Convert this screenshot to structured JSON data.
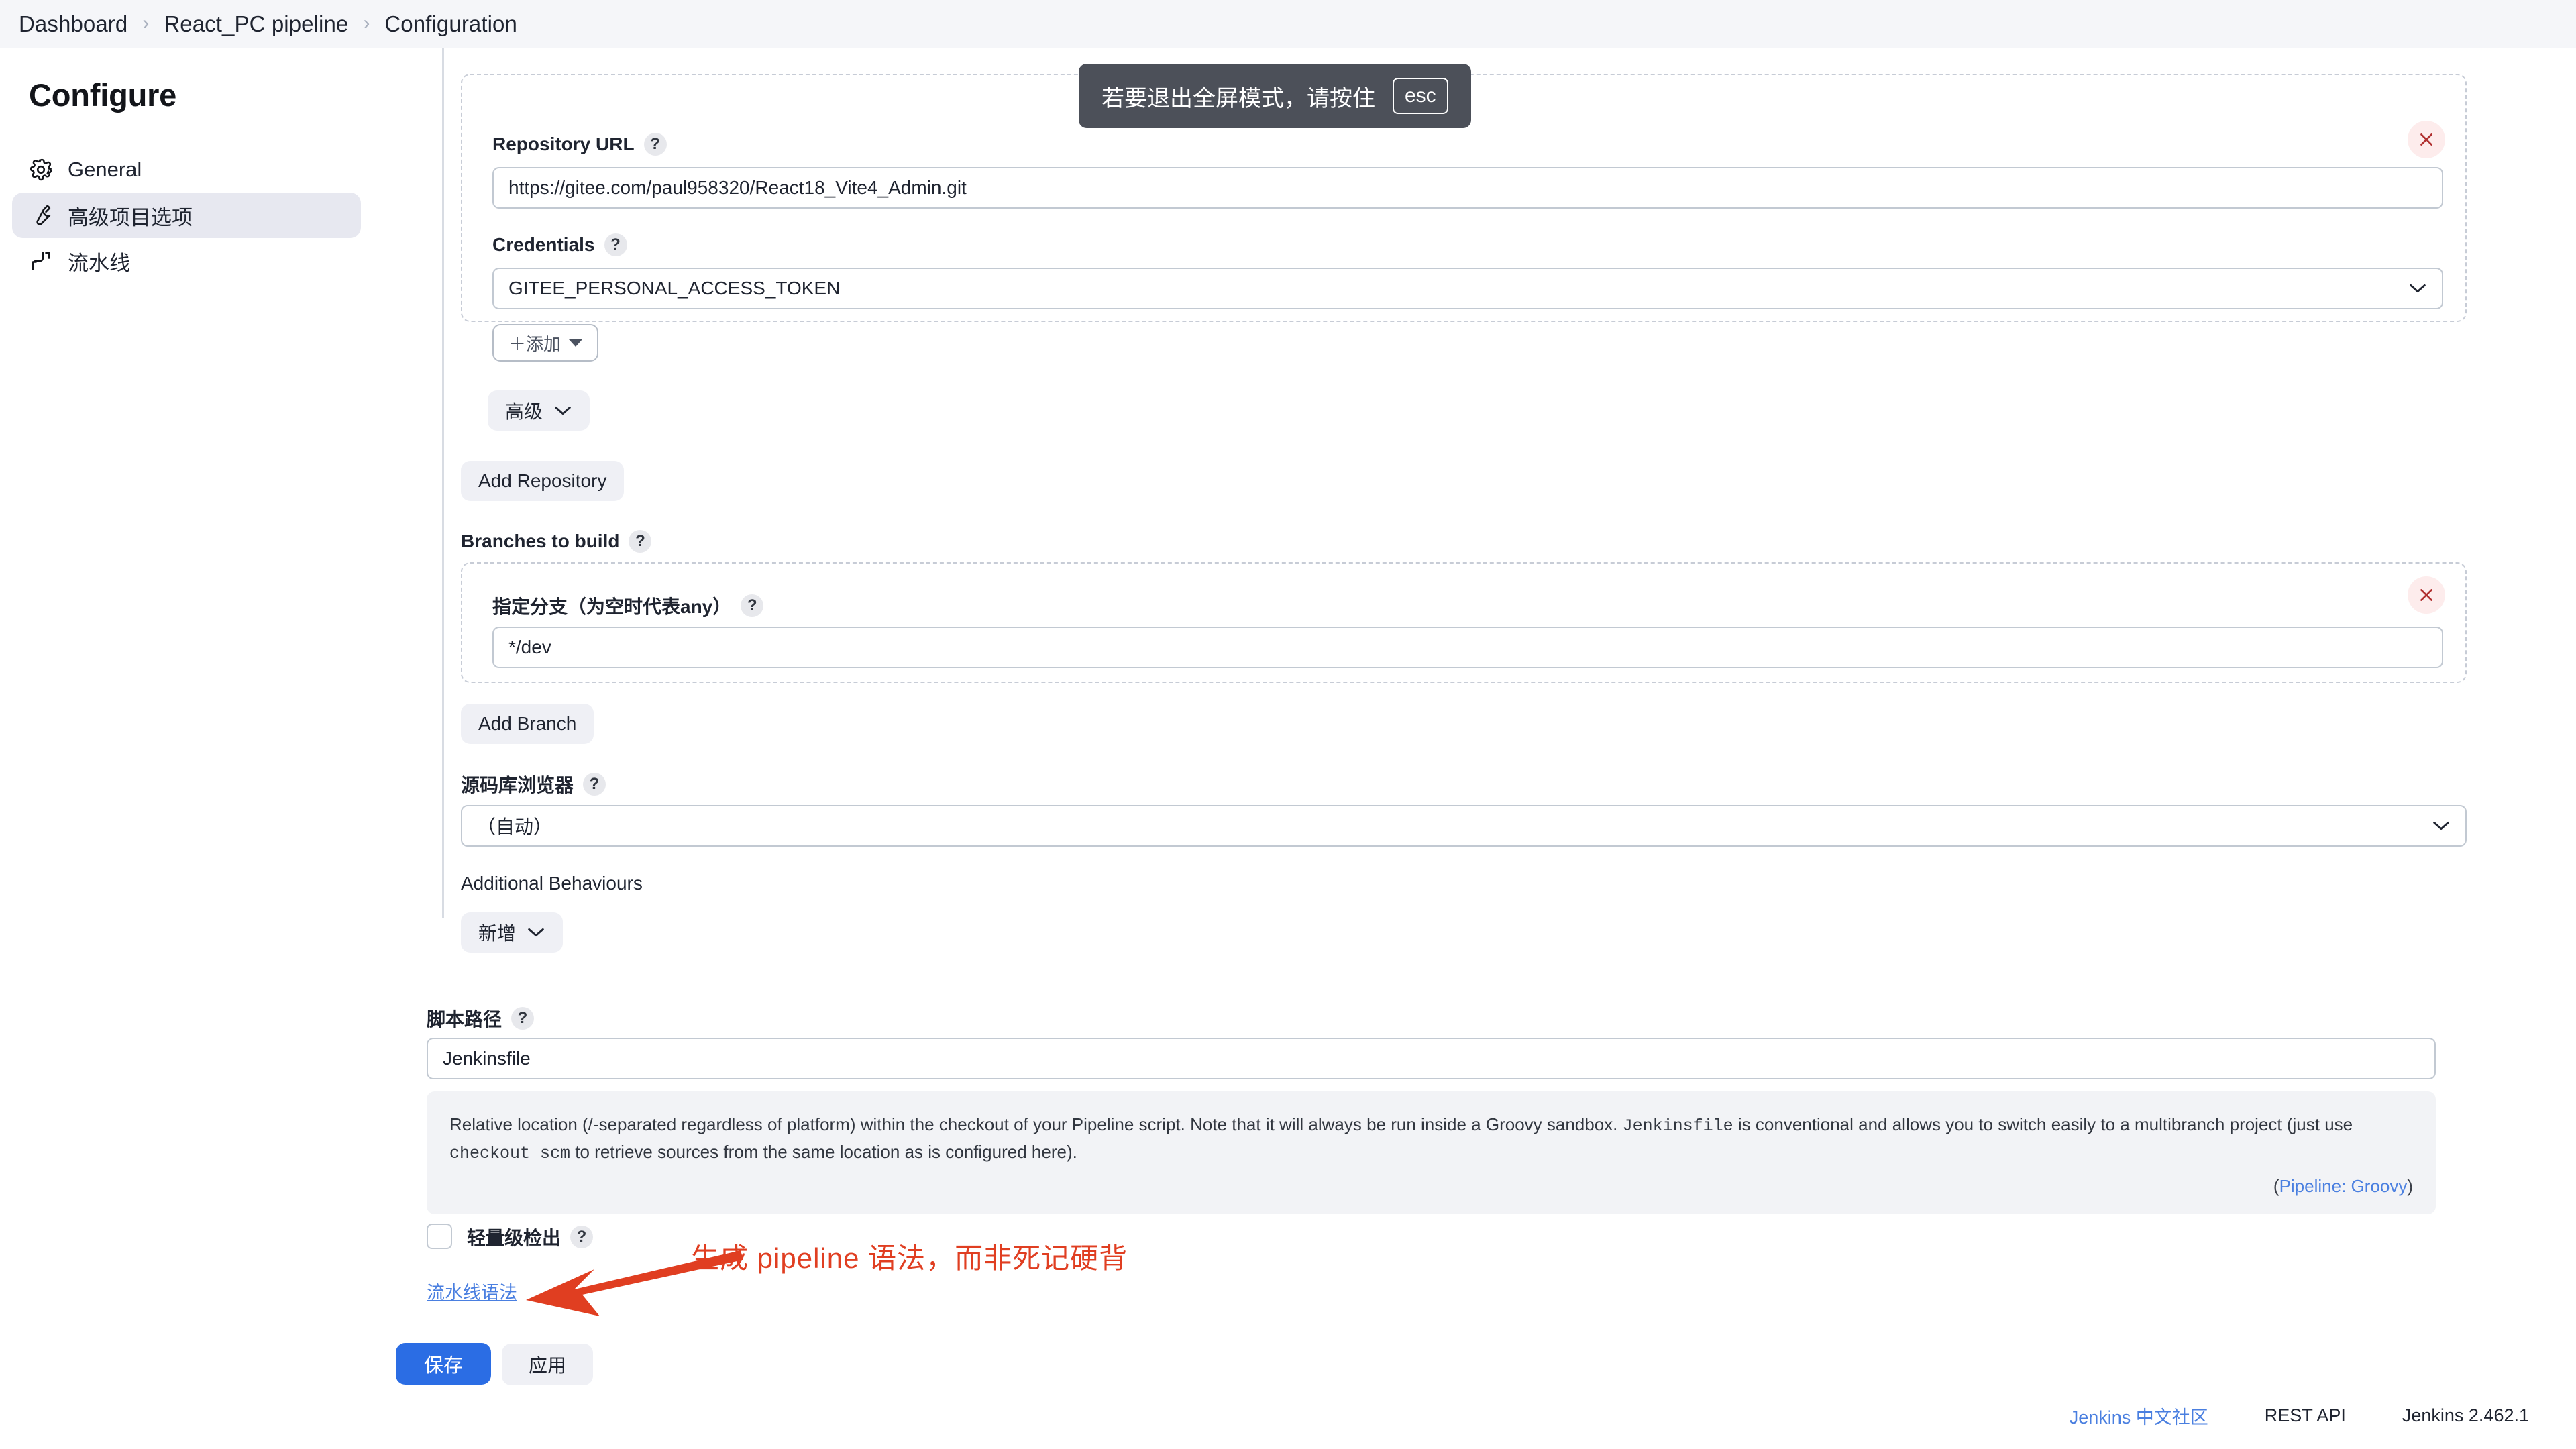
{
  "breadcrumb": {
    "items": [
      "Dashboard",
      "React_PC pipeline",
      "Configuration"
    ],
    "separator": "›"
  },
  "sidebar": {
    "title": "Configure",
    "items": [
      {
        "label": "General",
        "icon": "gear-icon",
        "active": false
      },
      {
        "label": "高级项目选项",
        "icon": "wrench-icon",
        "active": true
      },
      {
        "label": "流水线",
        "icon": "pipeline-icon",
        "active": false
      }
    ]
  },
  "fullscreen_toast": {
    "message": "若要退出全屏模式，请按住",
    "key": "esc"
  },
  "scm": {
    "repository": {
      "url_label": "Repository URL",
      "url_value": "https://gitee.com/paul958320/React18_Vite4_Admin.git",
      "credentials_label": "Credentials",
      "credentials_value": "GITEE_PERSONAL_ACCESS_TOKEN",
      "add_credentials_label": "＋添加",
      "advanced_label": "高级",
      "help": "?"
    },
    "add_repository_label": "Add Repository",
    "branches": {
      "section_label": "Branches to build",
      "branch_label": "指定分支（为空时代表any）",
      "branch_value": "*/dev",
      "add_branch_label": "Add Branch"
    },
    "browser": {
      "label": "源码库浏览器",
      "value": "（自动）"
    },
    "additional_behaviours": {
      "label": "Additional Behaviours",
      "add_label": "新增"
    }
  },
  "script": {
    "path_label": "脚本路径",
    "path_value": "Jenkinsfile",
    "description_part1": "Relative location (/-separated regardless of platform) within the checkout of your Pipeline script. Note that it will always be run inside a Groovy sandbox. ",
    "description_mono1": "Jenkinsfile",
    "description_part2": " is conventional and allows you to switch easily to a multibranch project (just use ",
    "description_mono2": "checkout scm",
    "description_part3": " to retrieve sources from the same location as is configured here).",
    "plugin_prefix": "(",
    "plugin_link": "Pipeline: Groovy",
    "plugin_suffix": ")"
  },
  "lightweight": {
    "label": "轻量级检出",
    "checked": false,
    "help": "?"
  },
  "pipeline_syntax_link": "流水线语法",
  "annotation": {
    "text": "生成 pipeline 语法，而非死记硬背",
    "color": "#e03e21"
  },
  "actions": {
    "save_label": "保存",
    "apply_label": "应用"
  },
  "footer": {
    "community_link": "Jenkins 中文社区",
    "rest_api": "REST API",
    "version": "Jenkins 2.462.1"
  },
  "colors": {
    "primary": "#2b6de4",
    "link": "#4a7fe0",
    "annotation": "#e03e21",
    "danger": "#b13030"
  }
}
